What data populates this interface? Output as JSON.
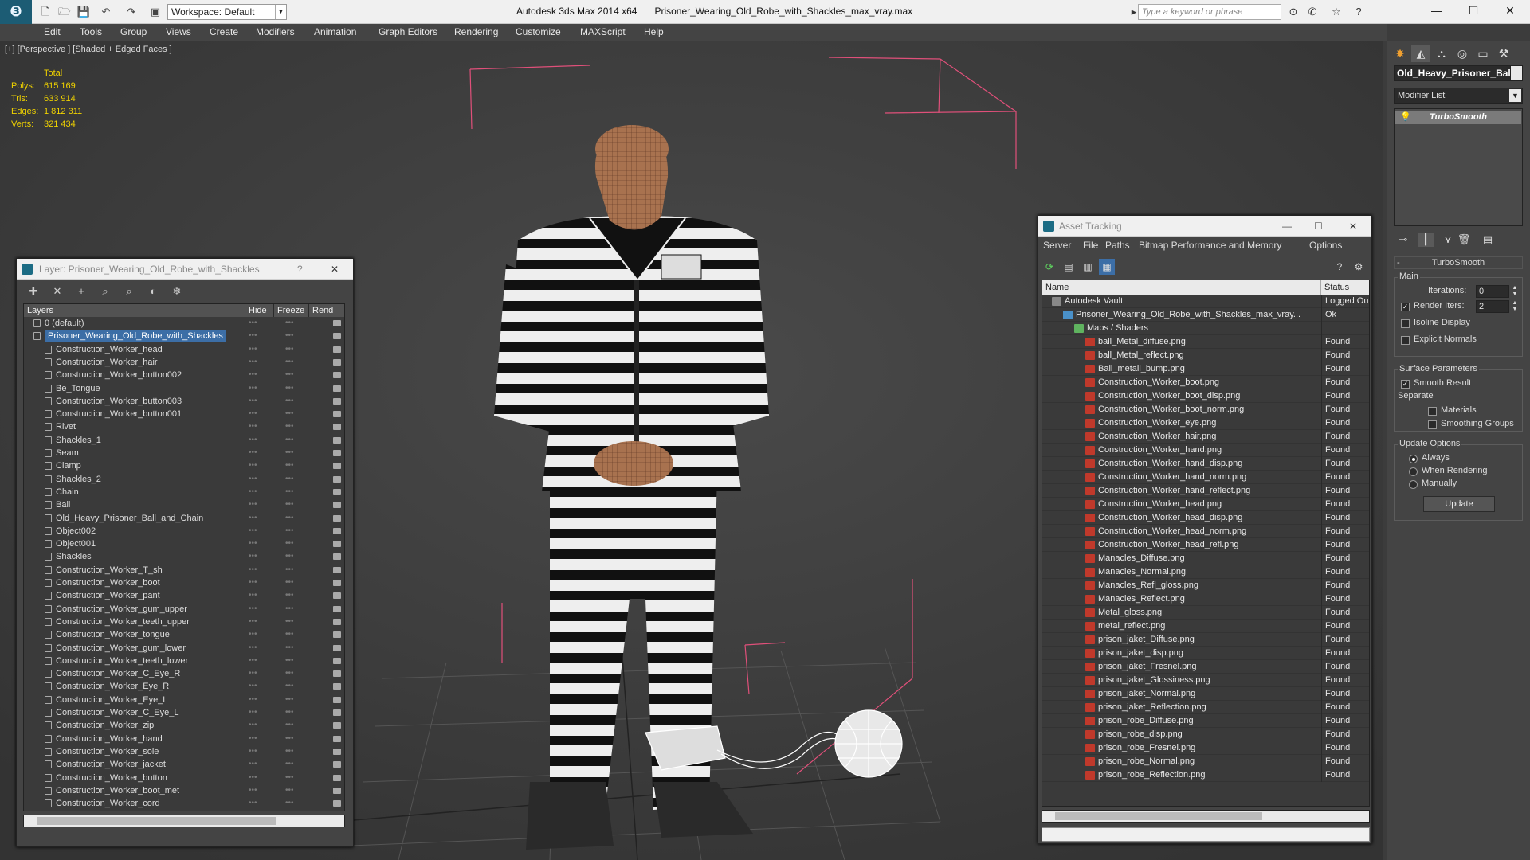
{
  "app": {
    "title": "Autodesk 3ds Max  2014 x64",
    "file": "Prisoner_Wearing_Old_Robe_with_Shackles_max_vray.max",
    "workspace": "Workspace: Default",
    "search_placeholder": "Type a keyword or phrase",
    "logo_icon": "3ds-max-logo-icon"
  },
  "menu": [
    "Edit",
    "Tools",
    "Group",
    "Views",
    "Create",
    "Modifiers",
    "Animation",
    "Graph Editors",
    "Rendering",
    "Customize",
    "MAXScript",
    "Help"
  ],
  "viewport": {
    "label": "[+] [Perspective ] [Shaded + Edged Faces ]",
    "stats": {
      "header": "Total",
      "rows": [
        {
          "k": "Polys:",
          "v": "615 169"
        },
        {
          "k": "Tris:",
          "v": "633 914"
        },
        {
          "k": "Edges:",
          "v": "1 812 311"
        },
        {
          "k": "Verts:",
          "v": "321 434"
        }
      ]
    }
  },
  "command_panel": {
    "object_name": "Old_Heavy_Prisoner_Ball",
    "modifier_list": "Modifier List",
    "stack_item": "TurboSmooth",
    "rollout_title": "TurboSmooth",
    "main": {
      "label": "Main",
      "iterations_label": "Iterations:",
      "iterations": "0",
      "render_iters_label": "Render Iters:",
      "render_iters": "2",
      "render_iters_checked": true,
      "isoline": "Isoline Display",
      "explicit": "Explicit Normals"
    },
    "surface": {
      "label": "Surface Parameters",
      "smooth_result": "Smooth Result",
      "separate": "Separate",
      "materials": "Materials",
      "smoothing_groups": "Smoothing Groups"
    },
    "update": {
      "label": "Update Options",
      "always": "Always",
      "when_rendering": "When Rendering",
      "manually": "Manually",
      "button": "Update"
    }
  },
  "layer_window": {
    "title": "Layer: Prisoner_Wearing_Old_Robe_with_Shackles",
    "help": "?",
    "columns": [
      "Layers",
      "Hide",
      "Freeze",
      "Rend"
    ],
    "rows": [
      {
        "name": "0 (default)",
        "level": 0,
        "type": "layer"
      },
      {
        "name": "Prisoner_Wearing_Old_Robe_with_Shackles",
        "level": 0,
        "type": "layer",
        "selected": true
      },
      {
        "name": "Construction_Worker_head",
        "level": 1
      },
      {
        "name": "Construction_Worker_hair",
        "level": 1
      },
      {
        "name": "Construction_Worker_button002",
        "level": 1
      },
      {
        "name": "Be_Tongue",
        "level": 1
      },
      {
        "name": "Construction_Worker_button003",
        "level": 1
      },
      {
        "name": "Construction_Worker_button001",
        "level": 1
      },
      {
        "name": "Rivet",
        "level": 1
      },
      {
        "name": "Shackles_1",
        "level": 1
      },
      {
        "name": "Seam",
        "level": 1
      },
      {
        "name": "Clamp",
        "level": 1
      },
      {
        "name": "Shackles_2",
        "level": 1
      },
      {
        "name": "Chain",
        "level": 1
      },
      {
        "name": "Ball",
        "level": 1
      },
      {
        "name": "Old_Heavy_Prisoner_Ball_and_Chain",
        "level": 1
      },
      {
        "name": "Object002",
        "level": 1
      },
      {
        "name": "Object001",
        "level": 1
      },
      {
        "name": "Shackles",
        "level": 1
      },
      {
        "name": "Construction_Worker_T_sh",
        "level": 1
      },
      {
        "name": "Construction_Worker_boot",
        "level": 1
      },
      {
        "name": "Construction_Worker_pant",
        "level": 1
      },
      {
        "name": "Construction_Worker_gum_upper",
        "level": 1
      },
      {
        "name": "Construction_Worker_teeth_upper",
        "level": 1
      },
      {
        "name": "Construction_Worker_tongue",
        "level": 1
      },
      {
        "name": "Construction_Worker_gum_lower",
        "level": 1
      },
      {
        "name": "Construction_Worker_teeth_lower",
        "level": 1
      },
      {
        "name": "Construction_Worker_C_Eye_R",
        "level": 1
      },
      {
        "name": "Construction_Worker_Eye_R",
        "level": 1
      },
      {
        "name": "Construction_Worker_Eye_L",
        "level": 1
      },
      {
        "name": "Construction_Worker_C_Eye_L",
        "level": 1
      },
      {
        "name": "Construction_Worker_zip",
        "level": 1
      },
      {
        "name": "Construction_Worker_hand",
        "level": 1
      },
      {
        "name": "Construction_Worker_sole",
        "level": 1
      },
      {
        "name": "Construction_Worker_jacket",
        "level": 1
      },
      {
        "name": "Construction_Worker_button",
        "level": 1
      },
      {
        "name": "Construction_Worker_boot_met",
        "level": 1
      },
      {
        "name": "Construction_Worker_cord",
        "level": 1
      },
      {
        "name": "Prisoner_Wearing_Old_Robe_with_Shackles",
        "level": 1
      }
    ]
  },
  "asset_window": {
    "title": "Asset Tracking",
    "menu": [
      "Server",
      "File",
      "Paths",
      "Bitmap Performance and Memory",
      "Options"
    ],
    "columns": [
      "Name",
      "Status"
    ],
    "rows": [
      {
        "name": "Autodesk Vault",
        "status": "Logged Out",
        "level": 0,
        "kind": "vault"
      },
      {
        "name": "Prisoner_Wearing_Old_Robe_with_Shackles_max_vray...",
        "status": "Ok",
        "level": 1,
        "kind": "file"
      },
      {
        "name": "Maps / Shaders",
        "status": "",
        "level": 2,
        "kind": "maps"
      },
      {
        "name": "ball_Metal_diffuse.png",
        "status": "Found",
        "level": 3,
        "kind": "png"
      },
      {
        "name": "ball_Metal_reflect.png",
        "status": "Found",
        "level": 3,
        "kind": "png"
      },
      {
        "name": "Ball_metall_bump.png",
        "status": "Found",
        "level": 3,
        "kind": "png"
      },
      {
        "name": "Construction_Worker_boot.png",
        "status": "Found",
        "level": 3,
        "kind": "png"
      },
      {
        "name": "Construction_Worker_boot_disp.png",
        "status": "Found",
        "level": 3,
        "kind": "png"
      },
      {
        "name": "Construction_Worker_boot_norm.png",
        "status": "Found",
        "level": 3,
        "kind": "png"
      },
      {
        "name": "Construction_Worker_eye.png",
        "status": "Found",
        "level": 3,
        "kind": "png"
      },
      {
        "name": "Construction_Worker_hair.png",
        "status": "Found",
        "level": 3,
        "kind": "png"
      },
      {
        "name": "Construction_Worker_hand.png",
        "status": "Found",
        "level": 3,
        "kind": "png"
      },
      {
        "name": "Construction_Worker_hand_disp.png",
        "status": "Found",
        "level": 3,
        "kind": "png"
      },
      {
        "name": "Construction_Worker_hand_norm.png",
        "status": "Found",
        "level": 3,
        "kind": "png"
      },
      {
        "name": "Construction_Worker_hand_reflect.png",
        "status": "Found",
        "level": 3,
        "kind": "png"
      },
      {
        "name": "Construction_Worker_head.png",
        "status": "Found",
        "level": 3,
        "kind": "png"
      },
      {
        "name": "Construction_Worker_head_disp.png",
        "status": "Found",
        "level": 3,
        "kind": "png"
      },
      {
        "name": "Construction_Worker_head_norm.png",
        "status": "Found",
        "level": 3,
        "kind": "png"
      },
      {
        "name": "Construction_Worker_head_refl.png",
        "status": "Found",
        "level": 3,
        "kind": "png"
      },
      {
        "name": "Manacles_Diffuse.png",
        "status": "Found",
        "level": 3,
        "kind": "png"
      },
      {
        "name": "Manacles_Normal.png",
        "status": "Found",
        "level": 3,
        "kind": "png"
      },
      {
        "name": "Manacles_Refl_gloss.png",
        "status": "Found",
        "level": 3,
        "kind": "png"
      },
      {
        "name": "Manacles_Reflect.png",
        "status": "Found",
        "level": 3,
        "kind": "png"
      },
      {
        "name": "Metal_gloss.png",
        "status": "Found",
        "level": 3,
        "kind": "png"
      },
      {
        "name": "metal_reflect.png",
        "status": "Found",
        "level": 3,
        "kind": "png"
      },
      {
        "name": "prison_jaket_Diffuse.png",
        "status": "Found",
        "level": 3,
        "kind": "png"
      },
      {
        "name": "prison_jaket_disp.png",
        "status": "Found",
        "level": 3,
        "kind": "png"
      },
      {
        "name": "prison_jaket_Fresnel.png",
        "status": "Found",
        "level": 3,
        "kind": "png"
      },
      {
        "name": "prison_jaket_Glossiness.png",
        "status": "Found",
        "level": 3,
        "kind": "png"
      },
      {
        "name": "prison_jaket_Normal.png",
        "status": "Found",
        "level": 3,
        "kind": "png"
      },
      {
        "name": "prison_jaket_Reflection.png",
        "status": "Found",
        "level": 3,
        "kind": "png"
      },
      {
        "name": "prison_robe_Diffuse.png",
        "status": "Found",
        "level": 3,
        "kind": "png"
      },
      {
        "name": "prison_robe_disp.png",
        "status": "Found",
        "level": 3,
        "kind": "png"
      },
      {
        "name": "prison_robe_Fresnel.png",
        "status": "Found",
        "level": 3,
        "kind": "png"
      },
      {
        "name": "prison_robe_Normal.png",
        "status": "Found",
        "level": 3,
        "kind": "png"
      },
      {
        "name": "prison_robe_Reflection.png",
        "status": "Found",
        "level": 3,
        "kind": "png"
      }
    ]
  },
  "colors": {
    "accent": "#3c6ea6",
    "stats": "#f0d200",
    "bbox": "#e0507a",
    "png_icon": "#c0392b",
    "ui_dark": "#444444"
  }
}
